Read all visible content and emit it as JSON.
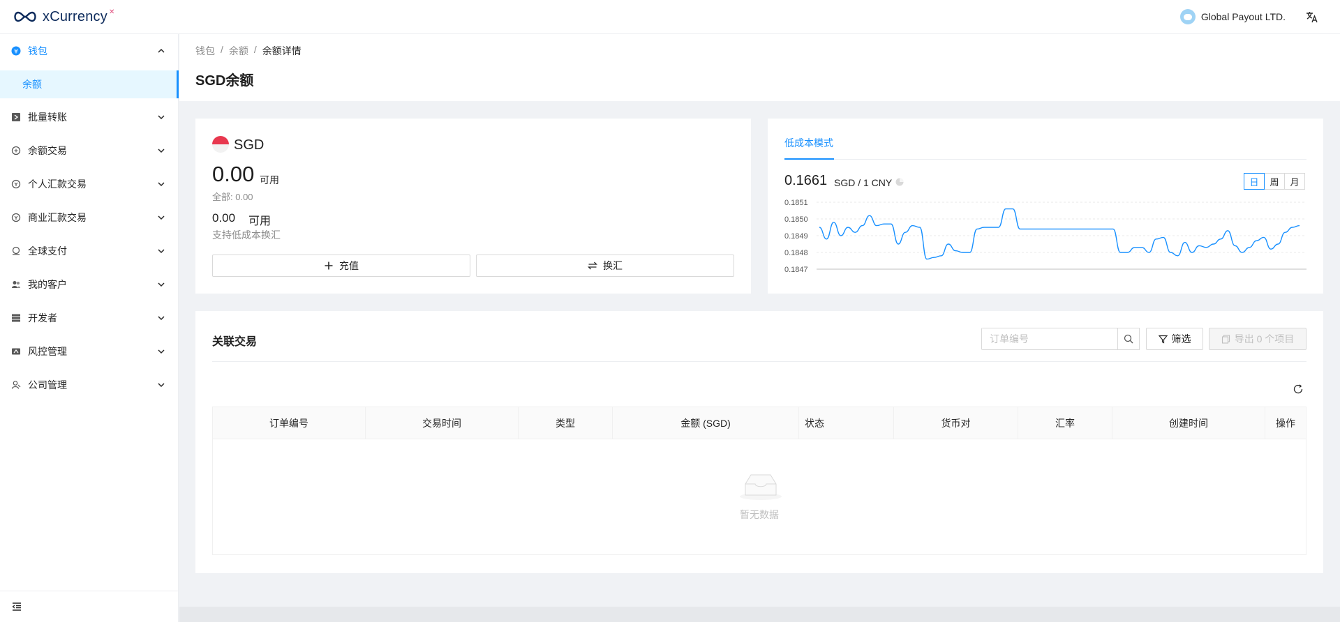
{
  "app": {
    "name": "xCurrency",
    "company_name": "Global Payout LTD."
  },
  "sidebar": {
    "items": [
      {
        "label": "钱包",
        "icon": "wallet-icon",
        "expanded": true
      },
      {
        "label": "批量转账",
        "icon": "batch-transfer-icon"
      },
      {
        "label": "余额交易",
        "icon": "balance-transaction-icon"
      },
      {
        "label": "个人汇款交易",
        "icon": "personal-remittance-icon"
      },
      {
        "label": "商业汇款交易",
        "icon": "business-remittance-icon"
      },
      {
        "label": "全球支付",
        "icon": "global-payment-icon"
      },
      {
        "label": "我的客户",
        "icon": "customers-icon"
      },
      {
        "label": "开发者",
        "icon": "developer-icon"
      },
      {
        "label": "风控管理",
        "icon": "risk-control-icon"
      },
      {
        "label": "公司管理",
        "icon": "company-management-icon"
      }
    ],
    "sub_item": "余额"
  },
  "breadcrumb": {
    "items": [
      "钱包",
      "余额",
      "余额详情"
    ],
    "separator": "/"
  },
  "page_title": "SGD余额",
  "balance_card": {
    "currency": "SGD",
    "available_amount": "0.00",
    "available_label": "可用",
    "total_line": "全部: 0.00",
    "low_cost_amount": "0.00",
    "low_cost_label": "可用",
    "low_cost_desc": "支持低成本换汇",
    "topup_label": "充值",
    "exchange_label": "换汇"
  },
  "rate_card": {
    "tab_label": "低成本模式",
    "rate_value": "0.1661",
    "rate_unit": "SGD / 1 CNY",
    "periods": [
      "日",
      "周",
      "月"
    ],
    "selected_period": "日"
  },
  "chart_data": {
    "type": "line",
    "title": "",
    "xlabel": "",
    "ylabel": "",
    "ylim": [
      0.1847,
      0.1851
    ],
    "yticks": [
      "0.1851",
      "0.1850",
      "0.1849",
      "0.1848",
      "0.1847"
    ],
    "grid": true,
    "series": [
      {
        "color": "#1890ff",
        "values": [
          0.18495,
          0.18488,
          0.18498,
          0.1849,
          0.18495,
          0.18492,
          0.18496,
          0.18502,
          0.18496,
          0.18497,
          0.18497,
          0.18485,
          0.18492,
          0.18496,
          0.18495,
          0.18476,
          0.18477,
          0.18478,
          0.18485,
          0.18481,
          0.1848,
          0.1848,
          0.18494,
          0.18495,
          0.18495,
          0.18495,
          0.18506,
          0.18506,
          0.18494,
          0.18494,
          0.18494,
          0.18494,
          0.18494,
          0.18494,
          0.18494,
          0.18494,
          0.18494,
          0.18494,
          0.18494,
          0.18494,
          0.18494,
          0.18494,
          0.1848,
          0.1848,
          0.18483,
          0.18483,
          0.1848,
          0.18488,
          0.18489,
          0.1848,
          0.18478,
          0.18486,
          0.1848,
          0.18484,
          0.18483,
          0.18485,
          0.18488,
          0.18493,
          0.18484,
          0.1848,
          0.18483,
          0.18487,
          0.18489,
          0.18482,
          0.18485,
          0.18492,
          0.18495,
          0.18496
        ]
      }
    ]
  },
  "transactions": {
    "title": "关联交易",
    "search_placeholder": "订单编号",
    "filter_label": "筛选",
    "export_label": "导出 0 个项目",
    "columns": [
      "订单编号",
      "交易时间",
      "类型",
      "金额 (SGD)",
      "状态",
      "货币对",
      "汇率",
      "创建时间",
      "操作"
    ],
    "empty_text": "暂无数据"
  }
}
